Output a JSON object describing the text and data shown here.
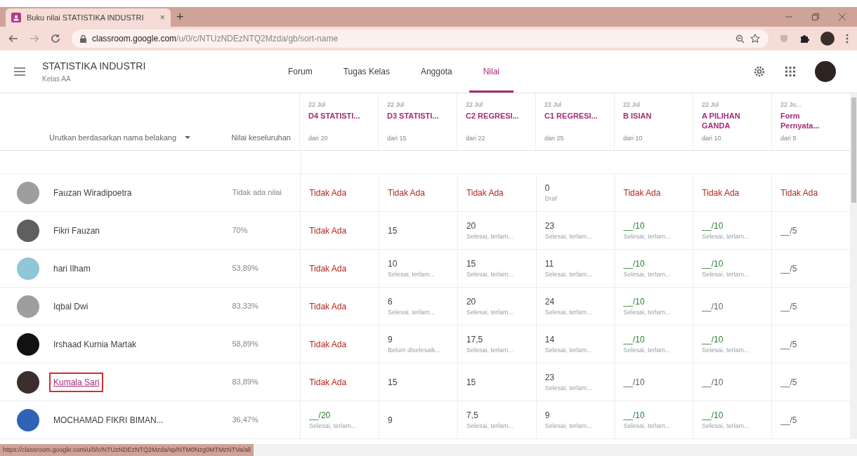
{
  "browser": {
    "tab_title": "Buku nilai STATISTIKA INDUSTRI",
    "tab_close": "×",
    "new_tab": "+",
    "url_host": "classroom.google.com",
    "url_path": "/u/0/c/NTUzNDEzNTQ2Mzda/gb/sort-name",
    "status_url": "https://classroom.google.com/u/0/c/NTUzNDEzNTQ2Mzda/sp/NTM0Nzg0MTMzNTVa/all"
  },
  "app": {
    "title": "STATISTIKA INDUSTRI",
    "subtitle": "Kelas AA"
  },
  "tabs": [
    {
      "label": "Forum",
      "selected": false
    },
    {
      "label": "Tugas Kelas",
      "selected": false
    },
    {
      "label": "Anggota",
      "selected": false
    },
    {
      "label": "Nilai",
      "selected": true
    }
  ],
  "table": {
    "sort_label": "Urutkan berdasarkan nama belakang",
    "overall_label": "Nilai keseluruhan",
    "columns": [
      {
        "date": "22 Jul",
        "title": "D4 STATISTI...",
        "points": "dari 20"
      },
      {
        "date": "22 Jul",
        "title": "D3 STATISTI...",
        "points": "dari 15"
      },
      {
        "date": "22 Jul",
        "title": "C2 REGRESI...",
        "points": "dari 22"
      },
      {
        "date": "22 Jul",
        "title": "C1 REGRESI...",
        "points": "dari 25"
      },
      {
        "date": "22 Jul",
        "title": "B ISIAN",
        "points": "dari 10"
      },
      {
        "date": "22 Jul",
        "title": "A PILIHAN GANDA",
        "points": "dari 10"
      },
      {
        "date": "22 Ju...",
        "title": "Form Pernyata...",
        "points": "dari 5"
      }
    ],
    "rows": [
      {
        "name": "Fauzan Wiradipoetra",
        "highlighted": false,
        "color": "#9e9e9e",
        "overall": "Tidak ada nilai",
        "cells": [
          {
            "kind": "missing",
            "value": "Tidak Ada"
          },
          {
            "kind": "missing",
            "value": "Tidak Ada"
          },
          {
            "kind": "missing",
            "value": "Tidak Ada"
          },
          {
            "kind": "score",
            "value": "0",
            "note": "Draf"
          },
          {
            "kind": "missing",
            "value": "Tidak Ada"
          },
          {
            "kind": "missing",
            "value": "Tidak Ada"
          },
          {
            "kind": "missing",
            "value": "Tidak Ada"
          }
        ]
      },
      {
        "name": "Fikri Fauzan",
        "highlighted": false,
        "color": "#5f5f5f",
        "overall": "70%",
        "cells": [
          {
            "kind": "missing",
            "value": "Tidak Ada"
          },
          {
            "kind": "score",
            "value": "15"
          },
          {
            "kind": "score",
            "value": "20",
            "note": "Selesai, terlam..."
          },
          {
            "kind": "score",
            "value": "23",
            "note": "Selesai, terlam..."
          },
          {
            "kind": "turned_in",
            "value": "__/10",
            "note": "Selesai, terlam..."
          },
          {
            "kind": "turned_in",
            "value": "__/10",
            "note": "Selesai, terlam..."
          },
          {
            "kind": "assigned",
            "value": "__/5"
          }
        ]
      },
      {
        "name": "hari Ilham",
        "highlighted": false,
        "color": "#8fc6d8",
        "overall": "53,89%",
        "cells": [
          {
            "kind": "missing",
            "value": "Tidak Ada"
          },
          {
            "kind": "score",
            "value": "10",
            "note": "Selesai, terlam..."
          },
          {
            "kind": "score",
            "value": "15",
            "note": "Selesai, terlam..."
          },
          {
            "kind": "score",
            "value": "11",
            "note": "Selesai, terlam..."
          },
          {
            "kind": "turned_in",
            "value": "__/10",
            "note": "Selesai, terlam..."
          },
          {
            "kind": "turned_in",
            "value": "__/10",
            "note": "Selesai, terlam..."
          },
          {
            "kind": "assigned",
            "value": "__/5"
          }
        ]
      },
      {
        "name": "Iqbal Dwi",
        "highlighted": false,
        "color": "#9e9e9e",
        "overall": "83,33%",
        "cells": [
          {
            "kind": "missing",
            "value": "Tidak Ada"
          },
          {
            "kind": "score",
            "value": "6",
            "note": "Selesai, terlam..."
          },
          {
            "kind": "score",
            "value": "20",
            "note": "Selesai, terlam..."
          },
          {
            "kind": "score",
            "value": "24",
            "note": "Selesai, terlam..."
          },
          {
            "kind": "turned_in",
            "value": "__/10",
            "note": "Selesai, terlam..."
          },
          {
            "kind": "assigned",
            "value": "__/10"
          },
          {
            "kind": "assigned",
            "value": "__/5"
          }
        ]
      },
      {
        "name": "Irshaad Kurnia Martak",
        "highlighted": false,
        "color": "#111111",
        "overall": "58,89%",
        "cells": [
          {
            "kind": "missing",
            "value": "Tidak Ada"
          },
          {
            "kind": "score",
            "value": "9",
            "note": "Belum diselesaik..."
          },
          {
            "kind": "score",
            "value": "17,5",
            "note": "Selesai, terlam..."
          },
          {
            "kind": "score",
            "value": "14",
            "note": "Selesai, terlam..."
          },
          {
            "kind": "turned_in",
            "value": "__/10",
            "note": "Selesai, terlam..."
          },
          {
            "kind": "turned_in",
            "value": "__/10",
            "note": "Selesai, terlam..."
          },
          {
            "kind": "assigned",
            "value": "__/5"
          }
        ]
      },
      {
        "name": "Kumala Sari",
        "highlighted": true,
        "color": "#3a2f2c",
        "overall": "83,89%",
        "cells": [
          {
            "kind": "missing",
            "value": "Tidak Ada"
          },
          {
            "kind": "score",
            "value": "15"
          },
          {
            "kind": "score",
            "value": "15"
          },
          {
            "kind": "score",
            "value": "23",
            "note": "Selesai, terlam..."
          },
          {
            "kind": "assigned",
            "value": "__/10"
          },
          {
            "kind": "assigned",
            "value": "__/10"
          },
          {
            "kind": "assigned",
            "value": "__/5"
          }
        ]
      },
      {
        "name": "MOCHAMAD FIKRI BIMAN...",
        "highlighted": false,
        "color": "#2f63b8",
        "overall": "36,47%",
        "cells": [
          {
            "kind": "turned_in",
            "value": "__/20",
            "note": "Selesai, terlam..."
          },
          {
            "kind": "score",
            "value": "9"
          },
          {
            "kind": "score",
            "value": "7,5",
            "note": "Selesai, terlam..."
          },
          {
            "kind": "score",
            "value": "9",
            "note": "Selesai, terlam..."
          },
          {
            "kind": "turned_in",
            "value": "__/10",
            "note": "Selesai, terlam..."
          },
          {
            "kind": "turned_in",
            "value": "__/10",
            "note": "Selesai, terlam..."
          },
          {
            "kind": "assigned",
            "value": "__/5"
          }
        ]
      }
    ]
  }
}
